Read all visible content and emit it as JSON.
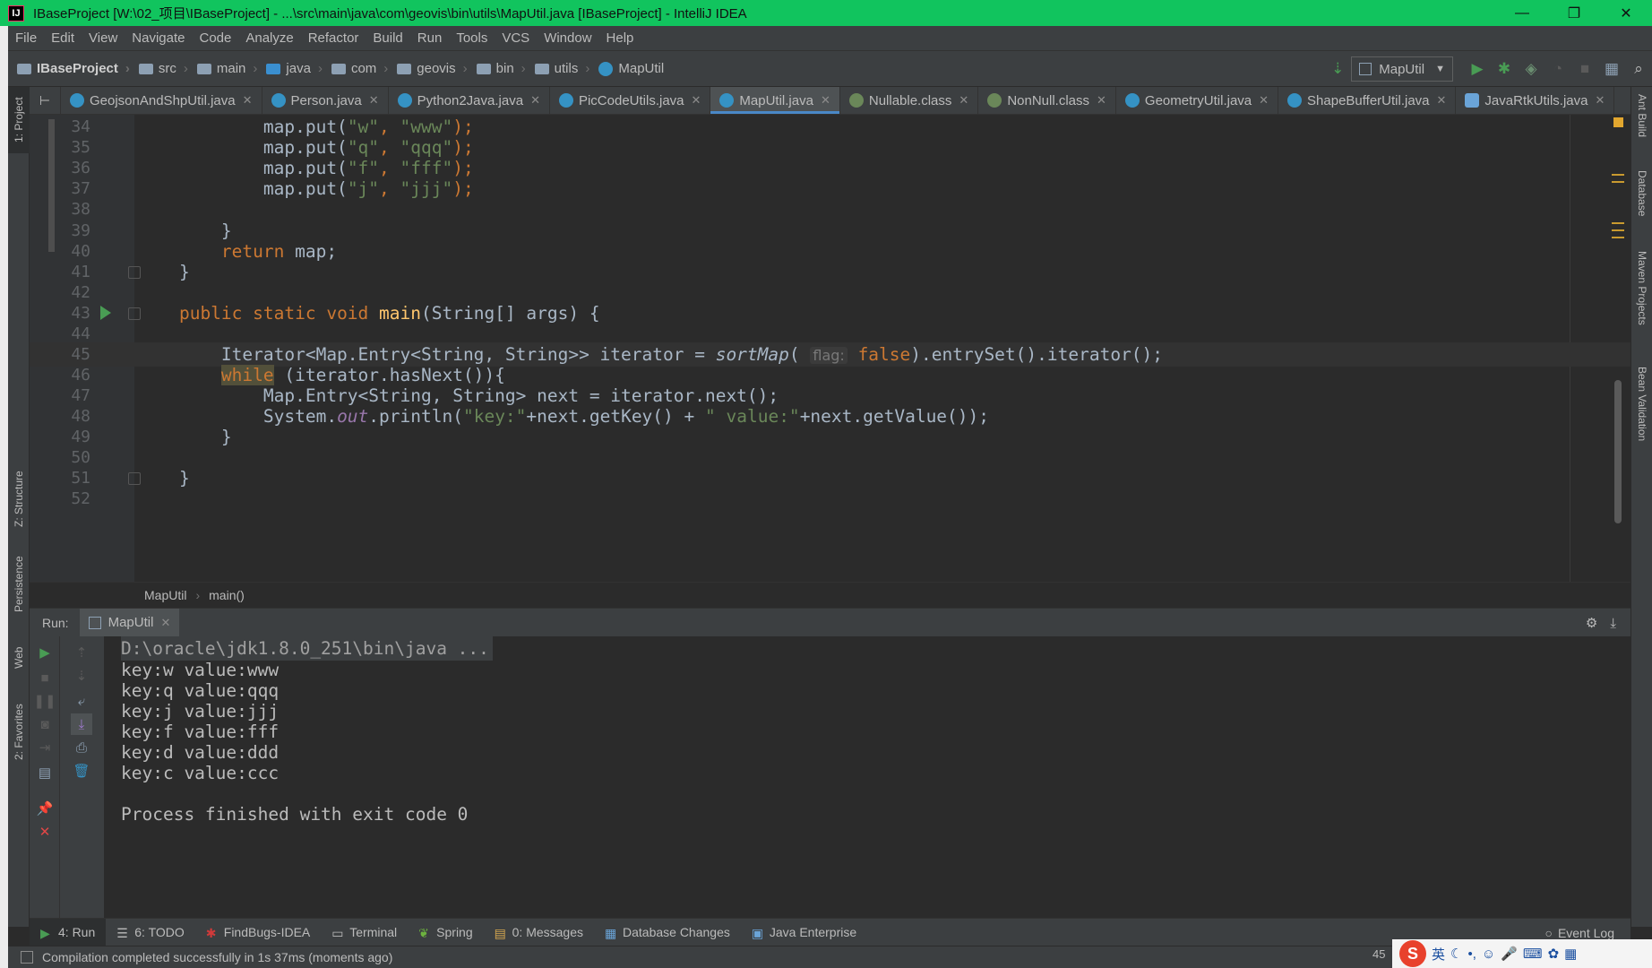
{
  "window": {
    "title": "IBaseProject [W:\\02_项目\\IBaseProject] - ...\\src\\main\\java\\com\\geovis\\bin\\utils\\MapUtil.java [IBaseProject] - IntelliJ IDEA",
    "app_icon_text": "IJ",
    "minimize": "—",
    "restore": "❐",
    "close": "✕"
  },
  "menu": [
    "File",
    "Edit",
    "View",
    "Navigate",
    "Code",
    "Analyze",
    "Refactor",
    "Build",
    "Run",
    "Tools",
    "VCS",
    "Window",
    "Help"
  ],
  "breadcrumb": [
    "IBaseProject",
    "src",
    "main",
    "java",
    "com",
    "geovis",
    "bin",
    "utils",
    "MapUtil"
  ],
  "run_config": {
    "name": "MapUtil"
  },
  "left_tool_windows": [
    "1: Project",
    "Z: Structure",
    "Persistence",
    "Web",
    "2: Favorites"
  ],
  "right_tool_windows": [
    "Ant Build",
    "Database",
    "Maven Projects",
    "Bean Validation"
  ],
  "tabs": [
    {
      "label": "GeojsonAndShpUtil.java",
      "icon": "class-icon",
      "active": false
    },
    {
      "label": "Person.java",
      "icon": "class-icon",
      "active": false
    },
    {
      "label": "Python2Java.java",
      "icon": "class-icon",
      "active": false
    },
    {
      "label": "PicCodeUtils.java",
      "icon": "class-icon",
      "active": false
    },
    {
      "label": "MapUtil.java",
      "icon": "class-icon",
      "active": true
    },
    {
      "label": "Nullable.class",
      "icon": "annotation-icon",
      "active": false
    },
    {
      "label": "NonNull.class",
      "icon": "annotation-icon",
      "active": false
    },
    {
      "label": "GeometryUtil.java",
      "icon": "class-icon",
      "active": false
    },
    {
      "label": "ShapeBufferUtil.java",
      "icon": "class-icon",
      "active": false
    },
    {
      "label": "JavaRtkUtils.java",
      "icon": "kotlin-file-icon",
      "active": false
    }
  ],
  "editor": {
    "line_numbers": [
      "34",
      "35",
      "36",
      "37",
      "38",
      "39",
      "40",
      "41",
      "42",
      "43",
      "44",
      "45",
      "46",
      "47",
      "48",
      "49",
      "50",
      "51",
      "52"
    ],
    "code": {
      "l34": {
        "pre": "            map.put(",
        "k": "\"w\"",
        "sep": ", ",
        "v": "\"www\"",
        "end": ");"
      },
      "l35": {
        "pre": "            map.put(",
        "k": "\"q\"",
        "sep": ", ",
        "v": "\"qqq\"",
        "end": ");"
      },
      "l36": {
        "pre": "            map.put(",
        "k": "\"f\"",
        "sep": ", ",
        "v": "\"fff\"",
        "end": ");"
      },
      "l37": {
        "pre": "            map.put(",
        "k": "\"j\"",
        "sep": ", ",
        "v": "\"jjj\"",
        "end": ");"
      },
      "l39": "        }",
      "l40_kw": "return",
      "l40_rest": " map;",
      "l41": "    }",
      "l43_mods": "public static void",
      "l43_name": "main",
      "l43_rest": "(String[] args) {",
      "l45_a": "        Iterator<Map.Entry<String, String>> iterator = ",
      "l45_call": "sortMap",
      "l45_paren": "( ",
      "l45_hint": "flag:",
      "l45_false": "false",
      "l45_b": ").entrySet().iterator();",
      "l46_kw": "while",
      "l46_rest": " (iterator.hasNext()){",
      "l47": "            Map.Entry<String, String> next = iterator.next();",
      "l48_a": "            System.",
      "l48_out": "out",
      "l48_b": ".println(",
      "l48_s1": "\"key:\"",
      "l48_c": "+next.getKey() + ",
      "l48_s2": "\" value:\"",
      "l48_d": "+next.getValue());",
      "l49": "        }",
      "l51": "    }"
    }
  },
  "editor_breadcrumb": [
    "MapUtil",
    "main()"
  ],
  "run_panel": {
    "label": "Run:",
    "tab": "MapUtil",
    "console": [
      "D:\\oracle\\jdk1.8.0_251\\bin\\java ...",
      "key:w value:www",
      "key:q value:qqq",
      "key:j value:jjj",
      "key:f value:fff",
      "key:d value:ddd",
      "key:c value:ccc",
      "",
      "Process finished with exit code 0"
    ]
  },
  "bottom_tools": [
    {
      "label": "4: Run",
      "active": true
    },
    {
      "label": "6: TODO",
      "active": false
    },
    {
      "label": "FindBugs-IDEA",
      "active": false
    },
    {
      "label": "Terminal",
      "active": false
    },
    {
      "label": "Spring",
      "active": false
    },
    {
      "label": "0: Messages",
      "active": false
    },
    {
      "label": "Database Changes",
      "active": false
    },
    {
      "label": "Java Enterprise",
      "active": false
    }
  ],
  "event_log": "Event Log",
  "status": {
    "message": "Compilation completed successfully in 1s 37ms (moments ago)",
    "position_partial": "45"
  },
  "ime": {
    "logo": "S",
    "mode": "英"
  },
  "colors": {
    "titlebar": "#11c45e",
    "panel": "#3c3f41",
    "editor_bg": "#2b2b2b",
    "keyword": "#cc7832",
    "string": "#6a8759",
    "function": "#ffc66d",
    "active_tab_underline": "#4a88c7",
    "run_green": "#499c54"
  }
}
